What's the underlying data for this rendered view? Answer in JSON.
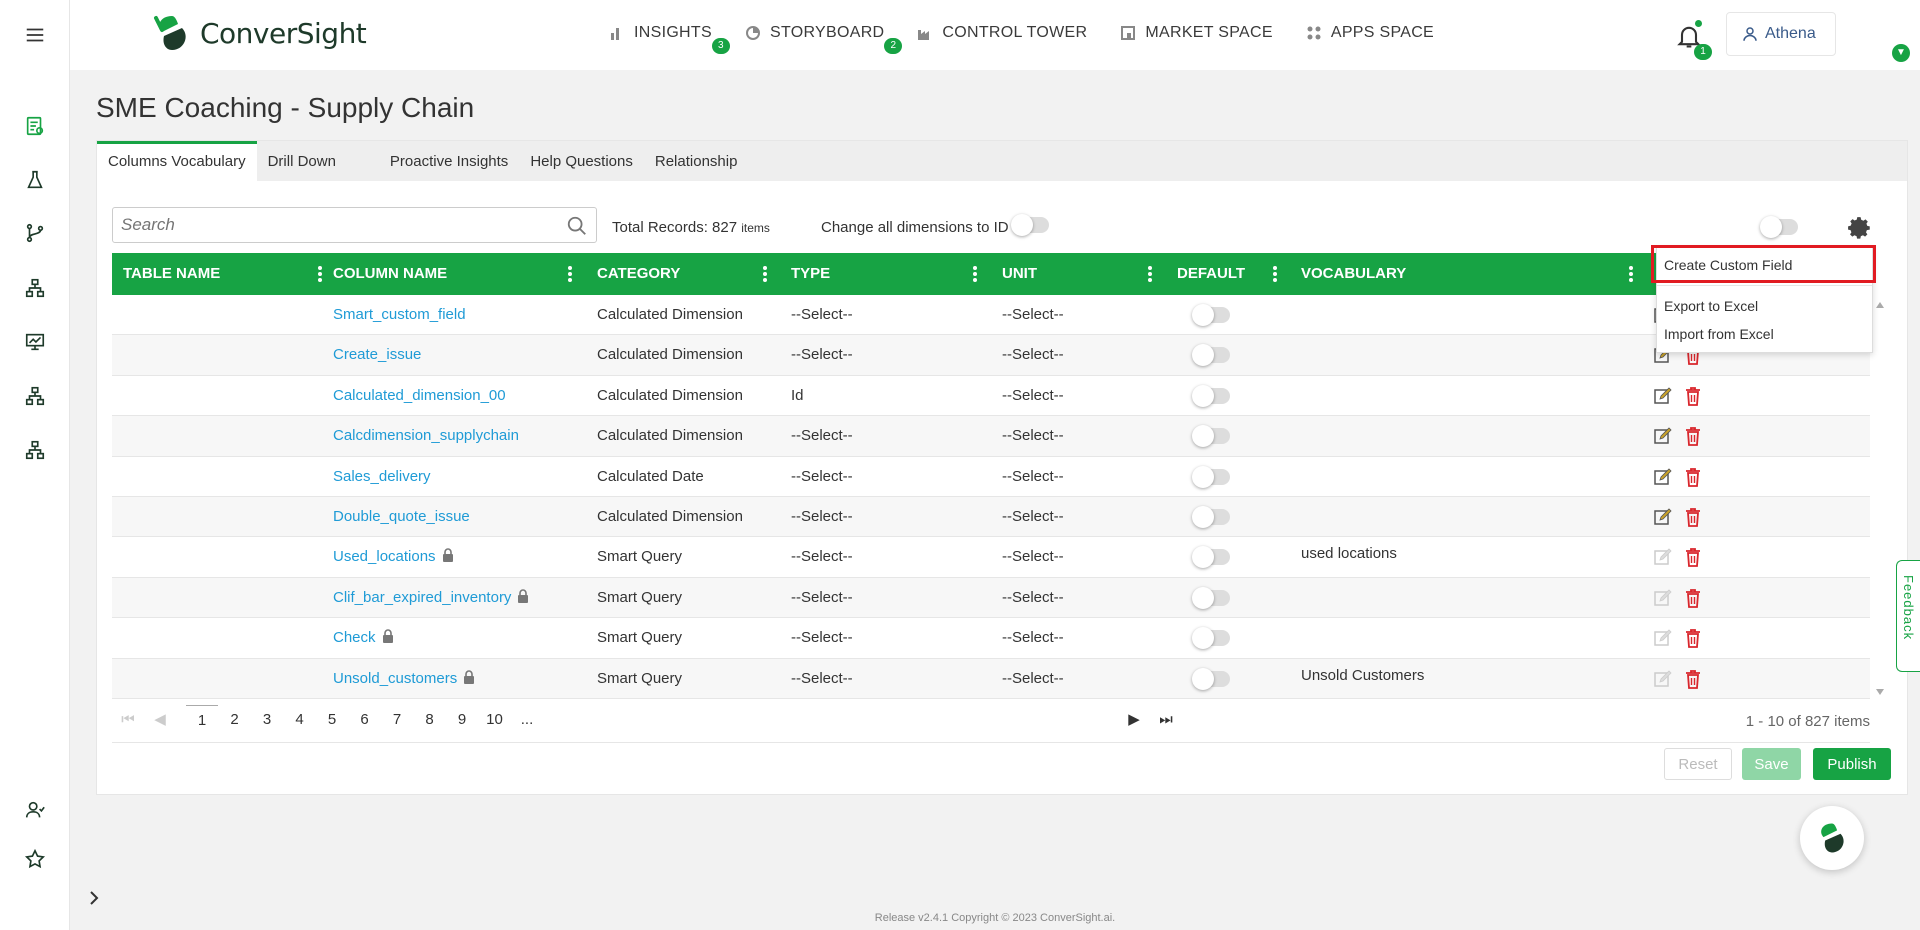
{
  "brand": {
    "name": "ConverSight",
    "accent": "#17a344"
  },
  "nav": [
    {
      "label": "INSIGHTS",
      "icon": "bar-chart-icon",
      "badge": "3"
    },
    {
      "label": "STORYBOARD",
      "icon": "pie-icon",
      "badge": "2"
    },
    {
      "label": "CONTROL TOWER",
      "icon": "factory-icon",
      "badge": ""
    },
    {
      "label": "MARKET SPACE",
      "icon": "store-icon",
      "badge": ""
    },
    {
      "label": "APPS SPACE",
      "icon": "apps-icon",
      "badge": ""
    }
  ],
  "notifications": {
    "count": "1"
  },
  "user": {
    "name": "Athena"
  },
  "page": {
    "title": "SME Coaching - Supply Chain"
  },
  "tabs": [
    {
      "label": "Columns Vocabulary",
      "active": true
    },
    {
      "label": "Drill Down",
      "active": false
    },
    {
      "label": "Proactive Insights",
      "active": false
    },
    {
      "label": "Help Questions",
      "active": false
    },
    {
      "label": "Relationship",
      "active": false
    }
  ],
  "toolbar": {
    "search_placeholder": "Search",
    "total_label": "Total Records: 827",
    "total_unit": "items",
    "dim_to_id_label": "Change all dimensions to ID"
  },
  "table": {
    "headers": [
      "TABLE NAME",
      "COLUMN NAME",
      "CATEGORY",
      "TYPE",
      "UNIT",
      "DEFAULT",
      "VOCABULARY"
    ],
    "rows": [
      {
        "table": "",
        "column": "Smart_custom_field",
        "locked": false,
        "category": "Calculated Dimension",
        "type": "--Select--",
        "unit": "--Select--",
        "vocabulary": "",
        "editable": true
      },
      {
        "table": "",
        "column": "Create_issue",
        "locked": false,
        "category": "Calculated Dimension",
        "type": "--Select--",
        "unit": "--Select--",
        "vocabulary": "",
        "editable": true
      },
      {
        "table": "",
        "column": "Calculated_dimension_00",
        "locked": false,
        "category": "Calculated Dimension",
        "type": "Id",
        "unit": "--Select--",
        "vocabulary": "",
        "editable": true
      },
      {
        "table": "",
        "column": "Calcdimension_supplychain",
        "locked": false,
        "category": "Calculated Dimension",
        "type": "--Select--",
        "unit": "--Select--",
        "vocabulary": "",
        "editable": true
      },
      {
        "table": "",
        "column": "Sales_delivery",
        "locked": false,
        "category": "Calculated Date",
        "type": "--Select--",
        "unit": "--Select--",
        "vocabulary": "",
        "editable": true
      },
      {
        "table": "",
        "column": "Double_quote_issue",
        "locked": false,
        "category": "Calculated Dimension",
        "type": "--Select--",
        "unit": "--Select--",
        "vocabulary": "",
        "editable": true
      },
      {
        "table": "",
        "column": "Used_locations",
        "locked": true,
        "category": "Smart Query",
        "type": "--Select--",
        "unit": "--Select--",
        "vocabulary": "used locations",
        "editable": false
      },
      {
        "table": "",
        "column": "Clif_bar_expired_inventory",
        "locked": true,
        "category": "Smart Query",
        "type": "--Select--",
        "unit": "--Select--",
        "vocabulary": "",
        "editable": false
      },
      {
        "table": "",
        "column": "Check",
        "locked": true,
        "category": "Smart Query",
        "type": "--Select--",
        "unit": "--Select--",
        "vocabulary": "",
        "editable": false
      },
      {
        "table": "",
        "column": "Unsold_customers",
        "locked": true,
        "category": "Smart Query",
        "type": "--Select--",
        "unit": "--Select--",
        "vocabulary": "Unsold Customers",
        "editable": false
      }
    ]
  },
  "pager": {
    "pages": [
      "1",
      "2",
      "3",
      "4",
      "5",
      "6",
      "7",
      "8",
      "9",
      "10",
      "..."
    ],
    "current": "1",
    "info": "1 - 10 of 827 items"
  },
  "actions": {
    "reset": "Reset",
    "save": "Save",
    "publish": "Publish"
  },
  "dropdown": {
    "items": [
      "Create Custom Field",
      "Export to Excel",
      "Import from Excel"
    ],
    "highlighted": "Create Custom Field",
    "highlight_color": "#e11b22"
  },
  "feedback": "Feedback",
  "footer": "Release v2.4.1 Copyright © 2023 ConverSight.ai."
}
